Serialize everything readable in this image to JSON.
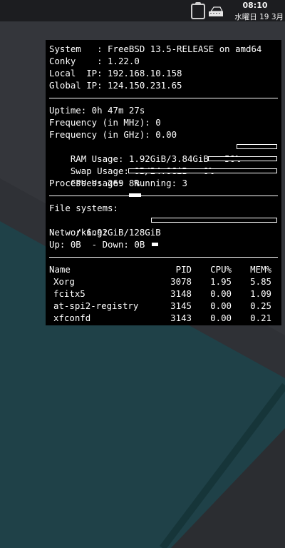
{
  "colors": {
    "wallpaper": "#2f3136",
    "teal": "#1f4148",
    "panel": "#000000",
    "text": "#ffffff"
  },
  "tray": {
    "clipboard_icon": "clipboard-icon",
    "input_icon": "keyboard-input-icon"
  },
  "clock": {
    "time": "08:10",
    "date": "水曜日 19 3月"
  },
  "conky": {
    "info": [
      "System   : FreeBSD 13.5-RELEASE on amd64",
      "Conky    : 1.22.0",
      "Local  IP: 192.168.10.158",
      "Global IP: 124.150.231.65"
    ],
    "uptime": "Uptime: 0h 47m 27s",
    "freq_mhz": "Frequency (in MHz): 0",
    "freq_ghz": "Frequency (in GHz): 0.00",
    "ram": {
      "text": "RAM Usage: 1.92GiB/3.84GiB - 50%",
      "percent": 50
    },
    "swap": {
      "text": "Swap Usage: 0B/24.0GiB - 0%",
      "percent": 0
    },
    "cpu": {
      "text": "CPU Usage: 8%",
      "percent": 8
    },
    "processes": "Processes: 269  Running: 3",
    "fs_label": "File systems:",
    "fs_root": {
      "text": " / 6.92GiB/128GiB",
      "percent": 5
    },
    "net_label": "Networking:",
    "net_line": "Up: 0B  - Down: 0B",
    "table": {
      "headers": {
        "name": "Name",
        "pid": "PID",
        "cpu": "CPU%",
        "mem": "MEM%"
      },
      "rows": [
        {
          "name": "Xorg",
          "pid": "3078",
          "cpu": "1.95",
          "mem": "5.85"
        },
        {
          "name": "fcitx5",
          "pid": "3148",
          "cpu": "0.00",
          "mem": "1.09"
        },
        {
          "name": "at-spi2-registry",
          "pid": "3145",
          "cpu": "0.00",
          "mem": "0.25"
        },
        {
          "name": "xfconfd",
          "pid": "3143",
          "cpu": "0.00",
          "mem": "0.21"
        }
      ]
    }
  }
}
